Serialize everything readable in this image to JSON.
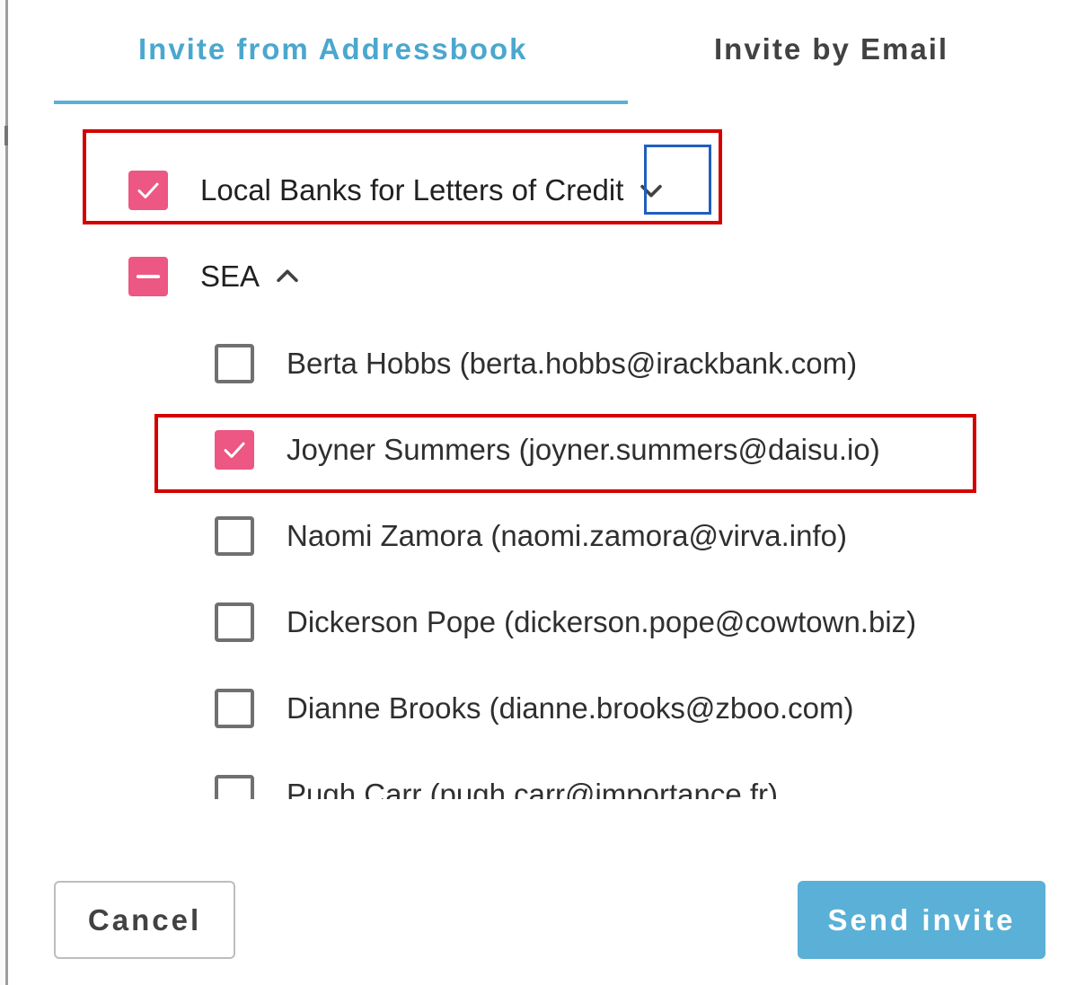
{
  "tabs": [
    {
      "label": "Invite from Addressbook"
    },
    {
      "label": "Invite by Email"
    }
  ],
  "groups": [
    {
      "label": "Local Banks for Letters of Credit",
      "state": "checked",
      "expanded": false
    },
    {
      "label": "SEA",
      "state": "mixed",
      "expanded": true
    }
  ],
  "contacts": [
    {
      "label": "Berta Hobbs (berta.hobbs@irackbank.com)",
      "checked": false
    },
    {
      "label": "Joyner Summers (joyner.summers@daisu.io)",
      "checked": true
    },
    {
      "label": "Naomi Zamora (naomi.zamora@virva.info)",
      "checked": false
    },
    {
      "label": "Dickerson Pope (dickerson.pope@cowtown.biz)",
      "checked": false
    },
    {
      "label": "Dianne Brooks (dianne.brooks@zboo.com)",
      "checked": false
    },
    {
      "label": "Pugh Carr (pugh.carr@importance.fr)",
      "checked": false
    }
  ],
  "buttons": {
    "cancel": "Cancel",
    "send": "Send invite"
  },
  "colors": {
    "accent": "#5ab0d6",
    "checkbox": "#ec5784",
    "highlight_red": "#d40000",
    "highlight_blue": "#1f5fbf"
  }
}
